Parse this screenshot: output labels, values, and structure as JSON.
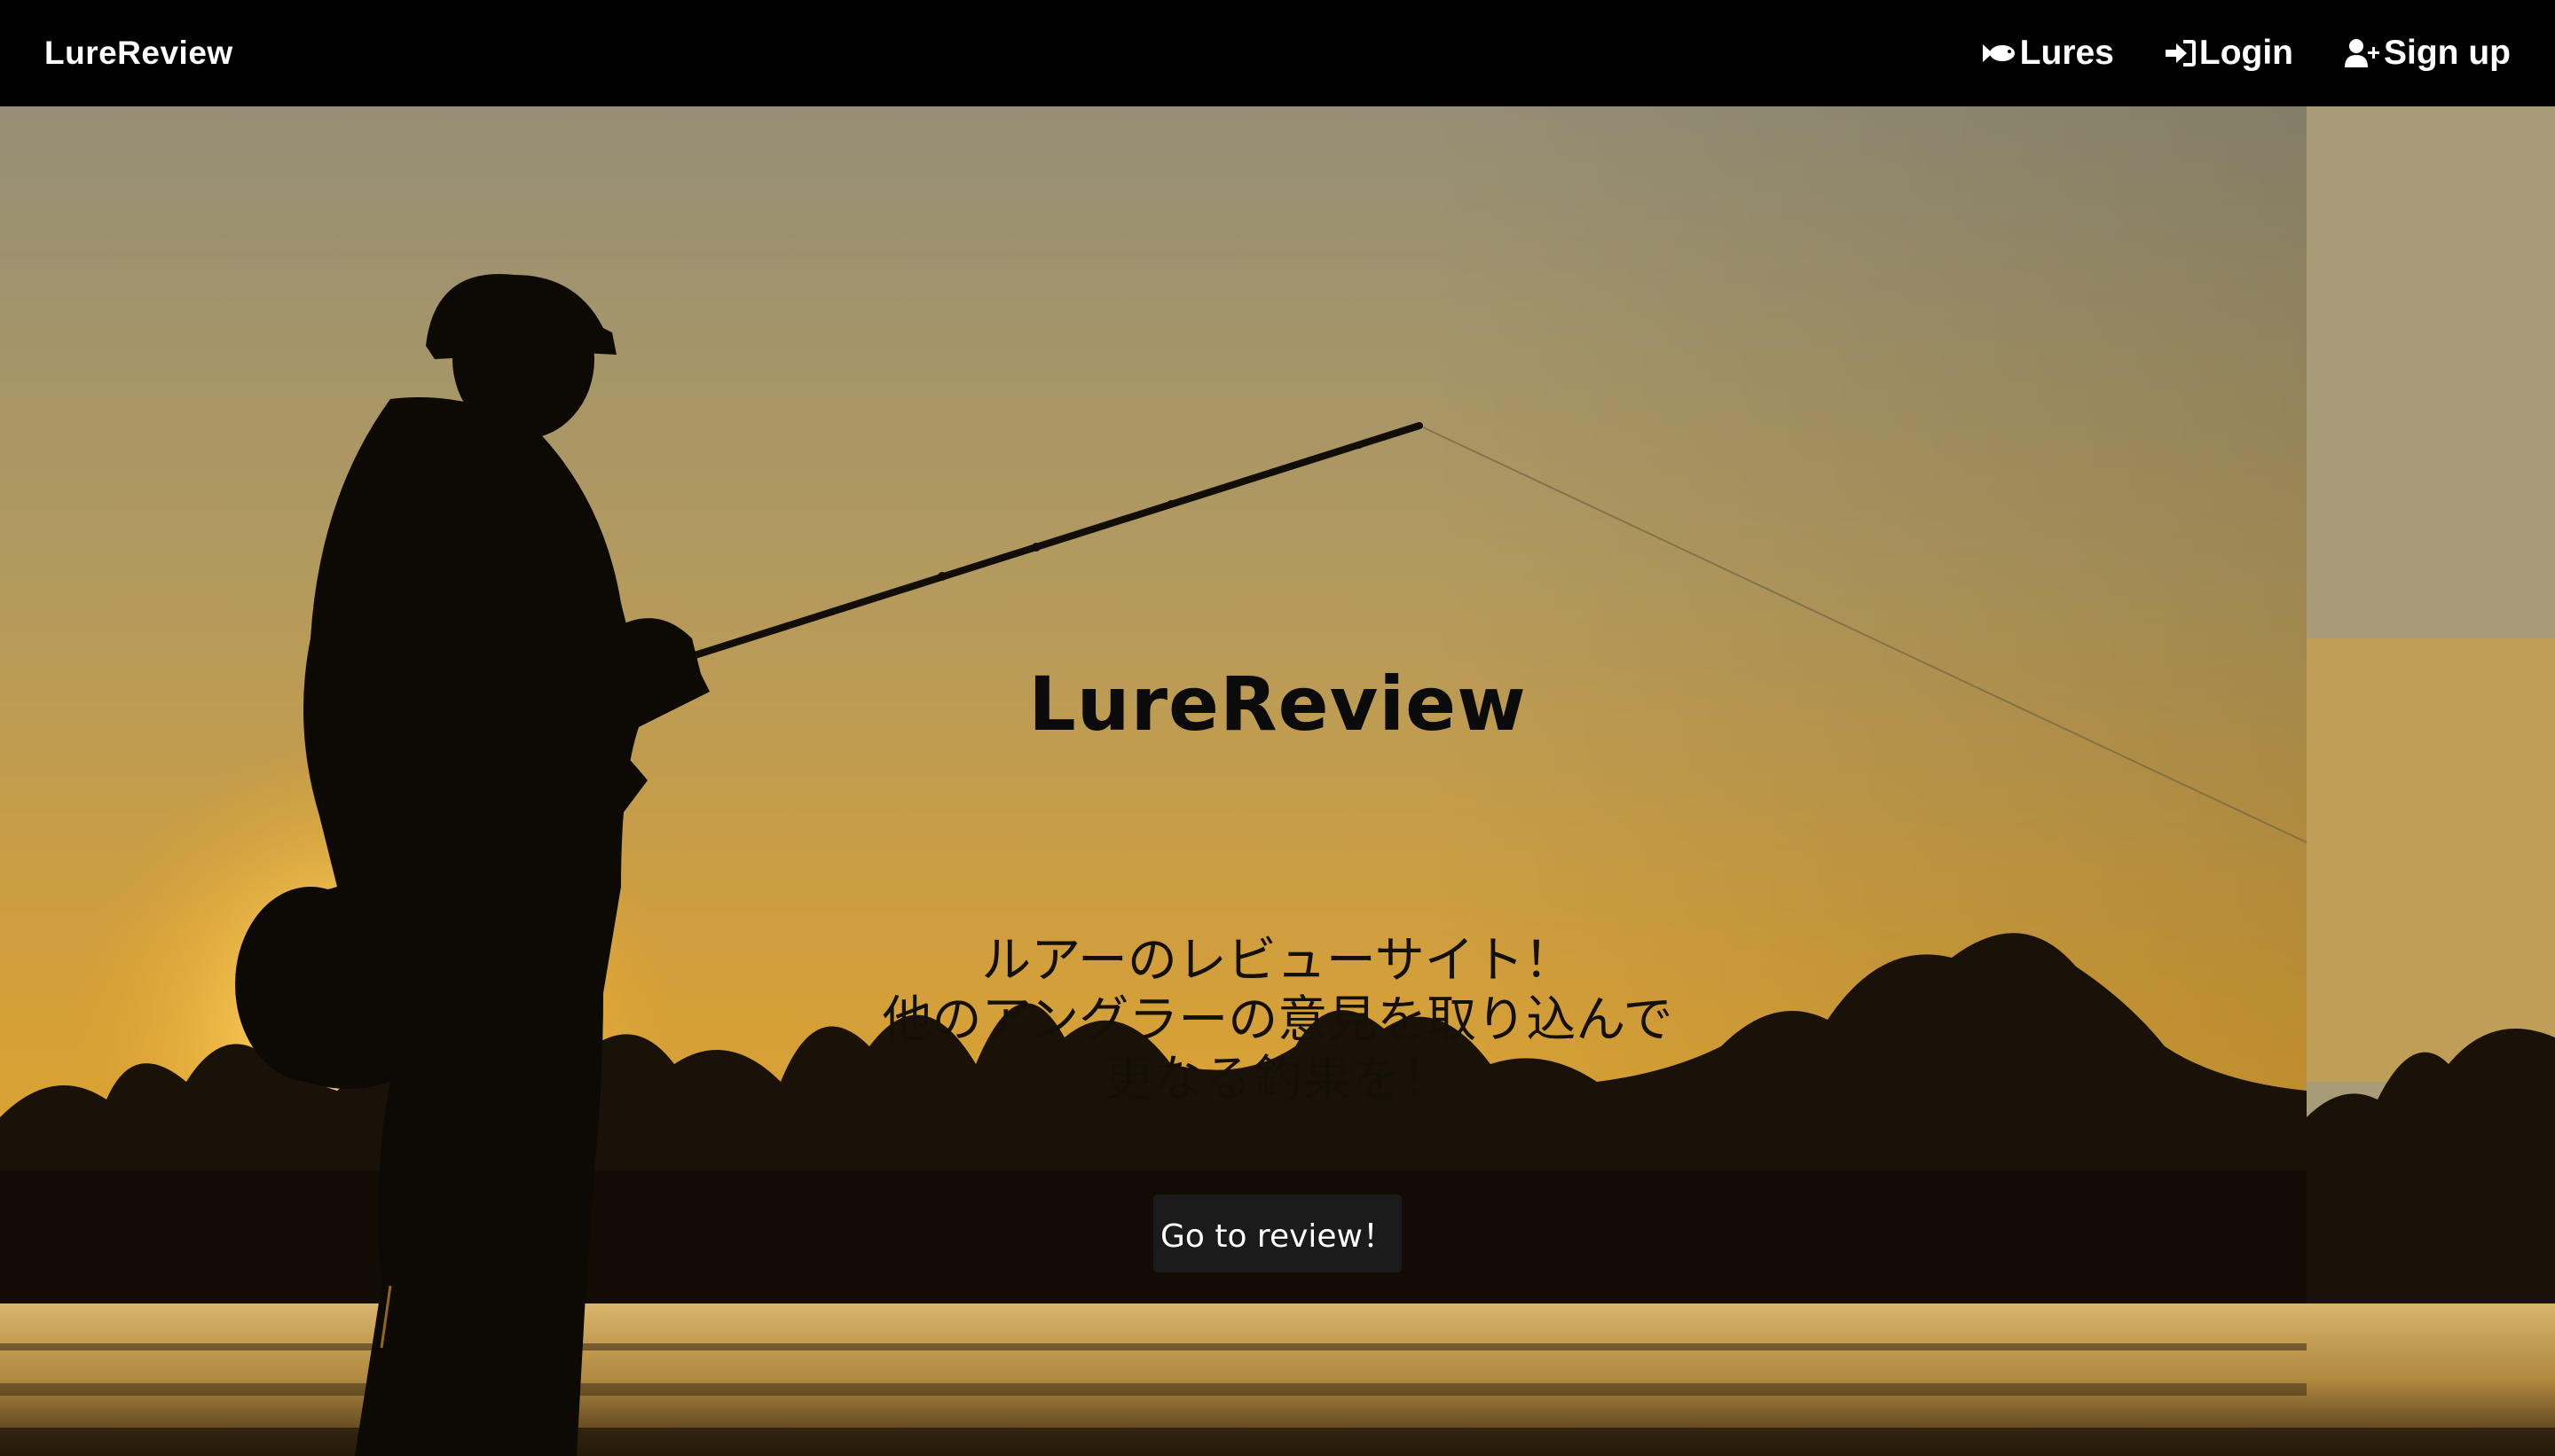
{
  "navbar": {
    "brand": "LureReview",
    "links": [
      {
        "label": "Lures",
        "icon": "fish-icon"
      },
      {
        "label": "Login",
        "icon": "sign-in-icon"
      },
      {
        "label": "Sign up",
        "icon": "user-plus-icon"
      }
    ]
  },
  "hero": {
    "title": "LureReview",
    "tagline": [
      "ルアーのレビューサイト！",
      "他のアングラーの意見を取り込んで",
      "更なる釣果を！"
    ],
    "cta_label": "Go to review！"
  },
  "colors": {
    "navbar_bg": "#000000",
    "button_bg": "#1b1b1b",
    "sky_top": "#8f8a73",
    "sky_glow": "#e9a925"
  }
}
